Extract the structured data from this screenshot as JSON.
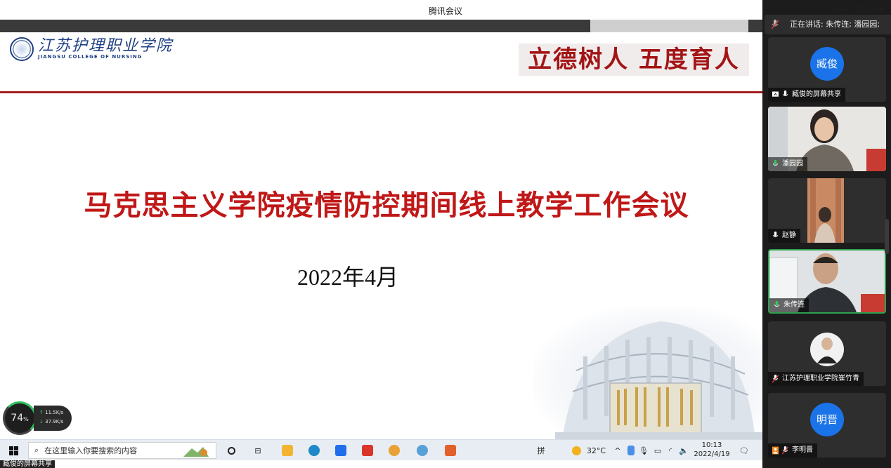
{
  "window": {
    "title": "腾讯会议",
    "controls": [
      "—",
      "▢",
      "✕"
    ]
  },
  "slide": {
    "school_name_cn": "江苏护理职业学院",
    "school_name_en": "JIANGSU COLLEGE OF NURSING",
    "motto": "立德树人 五度育人",
    "title": "马克思主义学院疫情防控期间线上教学工作会议",
    "date": "2022年4月"
  },
  "net_widget": {
    "percent": "74",
    "percent_unit": "%",
    "upload": "11.5",
    "upload_unit": "K/s",
    "download": "37.9",
    "download_unit": "K/s"
  },
  "taskbar": {
    "search_placeholder": "在这里输入你要搜索的内容",
    "ime": "拼",
    "weather": "32°C",
    "time": "10:13",
    "date": "2022/4/19"
  },
  "share_label": "臧俊的屏幕共享",
  "meeting": {
    "speaking_text": "正在讲话: 朱传连; 潘园园;",
    "participants": [
      {
        "name": "臧俊",
        "label": "臧俊的屏幕共享",
        "type": "avatar",
        "avatar_text": "臧俊",
        "mic": "on",
        "sharing": true
      },
      {
        "name": "潘园园",
        "label": "潘园园",
        "type": "video",
        "mic": "on-green"
      },
      {
        "name": "赵静",
        "label": "赵静",
        "type": "video",
        "mic": "on"
      },
      {
        "name": "朱传连",
        "label": "朱传连",
        "type": "video",
        "mic": "on-green",
        "active": true
      },
      {
        "name": "江苏护理职业学院崔竹青",
        "label": "江苏护理职业学院崔竹青",
        "type": "photo",
        "mic": "muted"
      },
      {
        "name": "李明晋",
        "label": "李明晋",
        "type": "avatar",
        "avatar_text": "明晋",
        "mic": "muted"
      }
    ]
  },
  "colors": {
    "slide_title_red": "#c01818",
    "motto_red": "#a31515",
    "divider_red": "#a11d21",
    "avatar_blue": "#1a73e8",
    "active_green": "#2ea04f",
    "panel_bg": "#1c1c1c"
  }
}
